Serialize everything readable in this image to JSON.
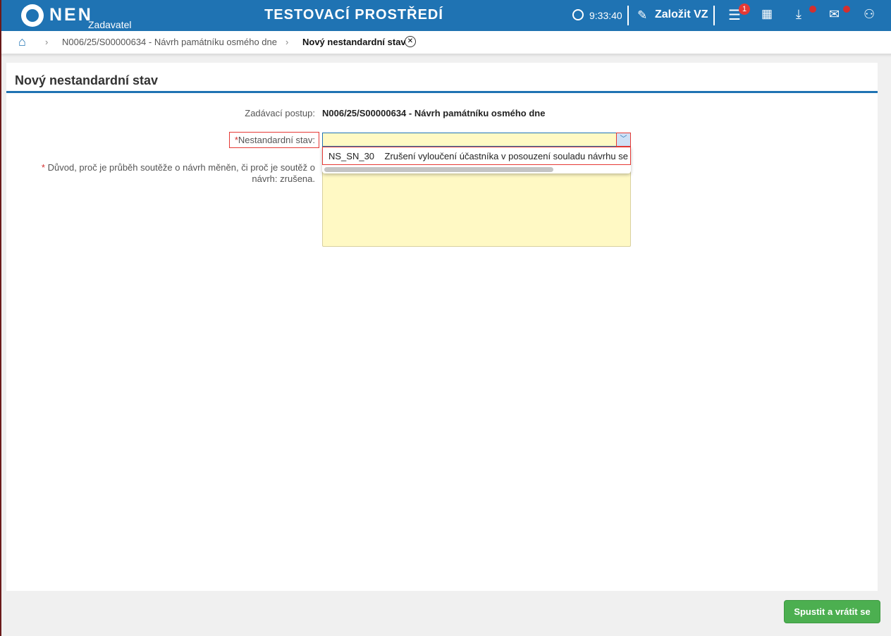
{
  "header": {
    "logo": "NEN",
    "logo_sub": "Zadavatel",
    "environment": "TESTOVACÍ PROSTŘEDÍ",
    "time": "9:33:40",
    "create_label": "Založit VZ",
    "menu_badge": "1"
  },
  "breadcrumb": {
    "items": [
      "N006/25/S00000634 - Návrh památníku osmého dne",
      "Nový nestandardní stav"
    ]
  },
  "form": {
    "title": "Nový nestandardní stav",
    "procedure_label": "Zadávací postup:",
    "procedure_value": "N006/25/S00000634 - Návrh památníku osmého dne",
    "state_label": "Nestandardní stav:",
    "state_value": "",
    "state_options": [
      {
        "code": "NS_SN_30",
        "text": "Zrušení vyloučení účastníka v posouzení souladu návrhu se s"
      }
    ],
    "reason_label": "Důvod, proč je průběh soutěže o návrh měněn, či proč je soutěž o návrh: zrušena.",
    "reason_value": "",
    "required_mark": "*"
  },
  "footer": {
    "submit_label": "Spustit a vrátit se"
  },
  "colors": {
    "header": "#1f73b3",
    "submit": "#4caf50",
    "field": "#fff9c4",
    "error": "#e53935"
  }
}
